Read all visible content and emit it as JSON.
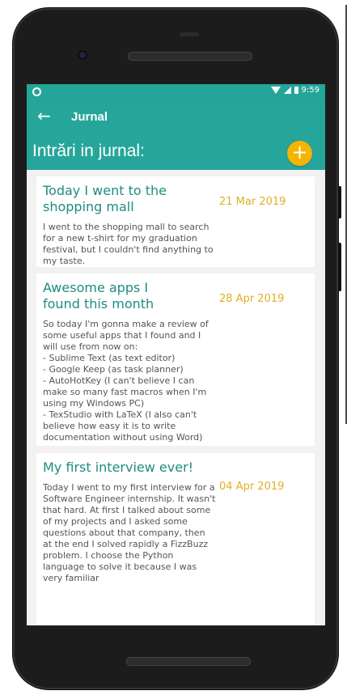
{
  "status_bar": {
    "time": "9:59"
  },
  "toolbar": {
    "back_icon": "arrow-left-icon",
    "title": "Jurnal"
  },
  "header": {
    "title": "Intrări in jurnal:",
    "add_icon": "+"
  },
  "entries": [
    {
      "title": "Today I went to the shopping mall",
      "date": "21 Mar 2019",
      "body": "I went to the shopping mall to search for a new t-shirt for my graduation festival, but I couldn't find anything to my taste."
    },
    {
      "title": "Awesome apps I found this month",
      "date": "28 Apr 2019",
      "body": "So today I'm gonna make a review of some useful apps that I found and I will use from now on:\n- Sublime Text (as text editor)\n- Google Keep (as task planner)\n- AutoHotKey (I can't believe I can make so many fast macros when I'm using my Windows PC)\n- TexStudio with LaTeX (I also can't believe how easy it is to write documentation without using Word)"
    },
    {
      "title": "My first interview ever!",
      "date": "04 Apr 2019",
      "body": "Today I went to my first interview for a Software Engineer internship. It wasn't that hard. At first I talked about some of my projects and I asked some questions about that company, then at the end I solved rapidly a FizzBuzz problem. I choose the Python language to solve it because I was very familiar"
    }
  ],
  "nav_bar": {
    "back_icon": "nav-back-icon",
    "home_icon": "nav-home-icon",
    "recents_icon": "nav-recents-icon"
  },
  "colors": {
    "primary": "#26a69a",
    "accent": "#f4b400",
    "title": "#1f8c82",
    "date": "#e0b020"
  }
}
